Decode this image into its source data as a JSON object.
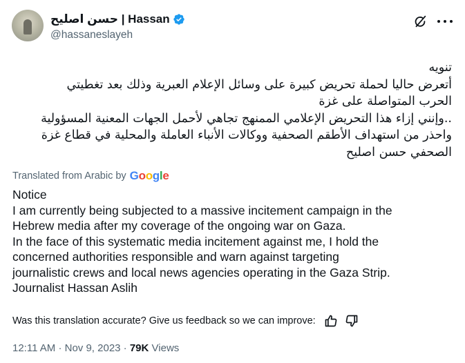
{
  "author": {
    "display_name": "حسن اصليح | Hassan",
    "handle": "@hassaneslayeh",
    "verified": true
  },
  "post": {
    "original_lines": [
      "تنويه",
      "أتعرض حاليا لحملة تحريض كبيرة على وسائل الإعلام العبرية وذلك بعد تغطيتي",
      "الحرب المتواصلة على غزة",
      "..وإنني إزاء هذا التحريض الإعلامي الممنهج تجاهي لأحمل الجهات المعنية المسؤولية",
      "واحذر من استهداف الأطقم الصحفية ووكالات الأنباء العاملة والمحلية في قطاع غزة",
      "الصحفي حسن اصليح"
    ],
    "translated_by_label": "Translated from Arabic by",
    "translator_brand": "Google",
    "translation_lines": [
      "Notice",
      "I am currently being subjected to a massive incitement campaign in the",
      "Hebrew media after my coverage of the ongoing war on Gaza.",
      "In the face of this systematic media incitement against me, I hold the",
      "concerned authorities responsible and warn against targeting",
      "journalistic crews and local news agencies operating in the Gaza Strip.",
      "Journalist Hassan Aslih"
    ],
    "feedback_prompt": "Was this translation accurate? Give us feedback so we can improve:",
    "time": "12:11 AM",
    "date": "Nov 9, 2023",
    "views_count": "79K",
    "views_label": "Views"
  },
  "colors": {
    "verified_blue": "#1d9bf0",
    "secondary_text": "#536471",
    "google_blue": "#4285f4",
    "google_red": "#ea4335",
    "google_yellow": "#fbbc05",
    "google_green": "#34a853"
  },
  "icons": {
    "verified": "verified-badge-icon",
    "grok": "grok-icon",
    "more": "more-options-icon",
    "thumbs_up": "thumbs-up-icon",
    "thumbs_down": "thumbs-down-icon"
  }
}
